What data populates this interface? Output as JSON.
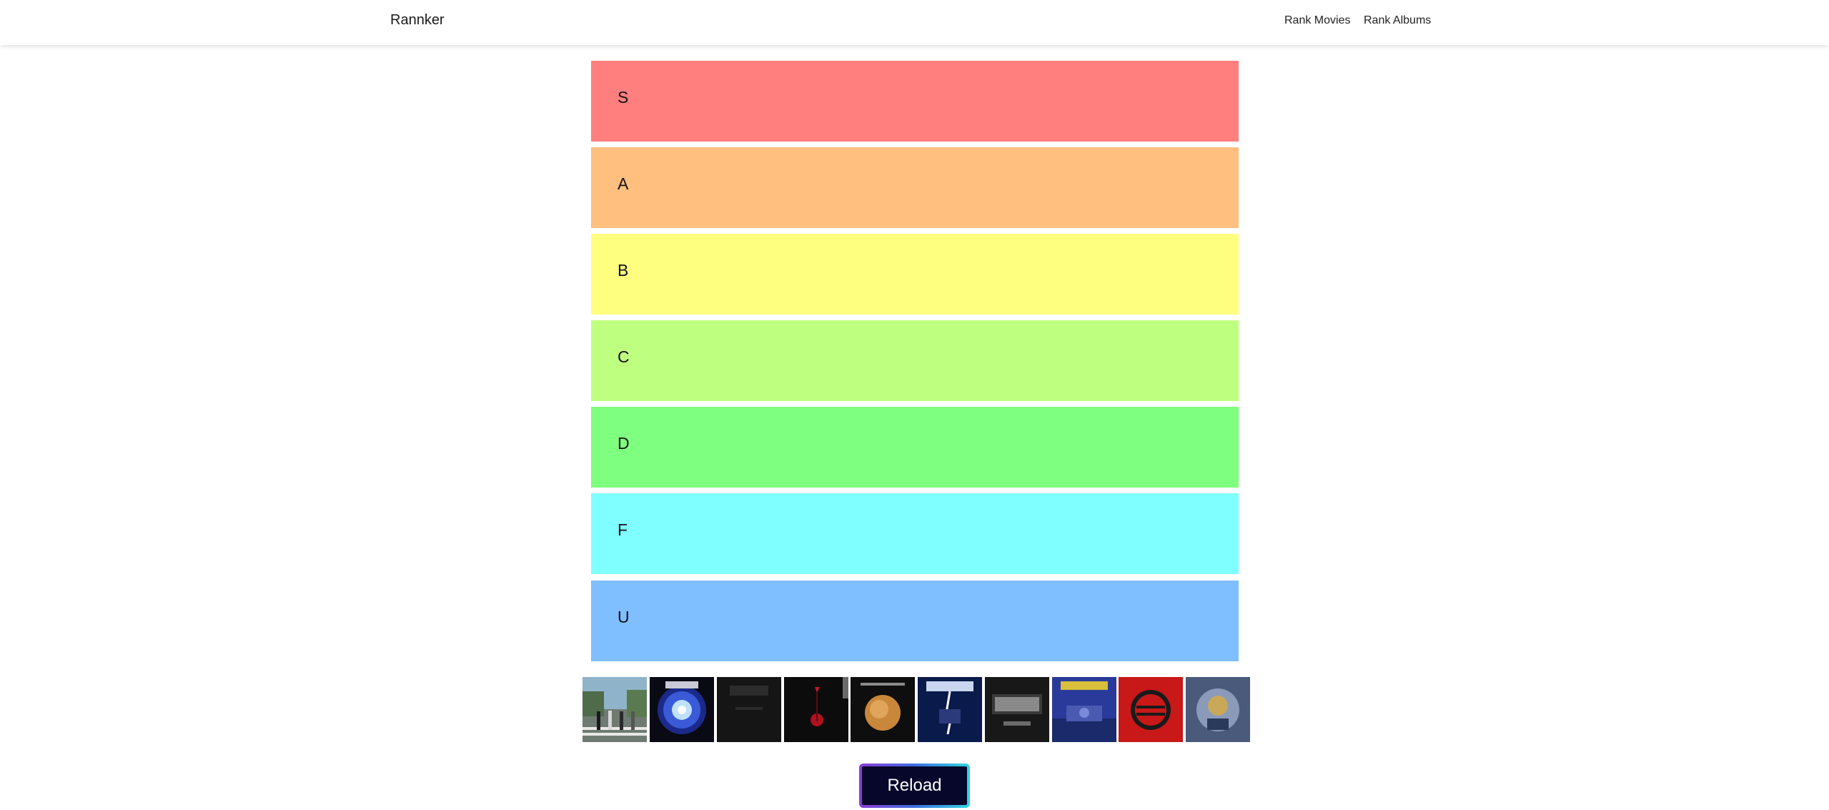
{
  "navbar": {
    "brand": "Rannker",
    "links": [
      {
        "label": "Rank Movies"
      },
      {
        "label": "Rank Albums"
      }
    ]
  },
  "tiers": [
    {
      "label": "S",
      "color": "#ff7f7f"
    },
    {
      "label": "A",
      "color": "#ffbf7f"
    },
    {
      "label": "B",
      "color": "#ffff7f"
    },
    {
      "label": "C",
      "color": "#bfff7f"
    },
    {
      "label": "D",
      "color": "#7fff7f"
    },
    {
      "label": "F",
      "color": "#7fffff"
    },
    {
      "label": "U",
      "color": "#7fbfff"
    }
  ],
  "albums": [
    {
      "icon": "abbey-road-cover"
    },
    {
      "icon": "aerosmith-cover"
    },
    {
      "icon": "back-in-black-cover"
    },
    {
      "icon": "violator-cover"
    },
    {
      "icon": "steven-wilson-cover"
    },
    {
      "icon": "ride-the-lightning-cover"
    },
    {
      "icon": "rock-or-bust-cover"
    },
    {
      "icon": "rust-in-peace-cover"
    },
    {
      "icon": "st-anger-cover"
    },
    {
      "icon": "sonata-arctica-cover"
    }
  ],
  "reload_label": "Reload",
  "colors": {
    "reload_bg": "#07072b",
    "reload_border_start": "#8a3bd6",
    "reload_border_end": "#2fd6e0"
  }
}
